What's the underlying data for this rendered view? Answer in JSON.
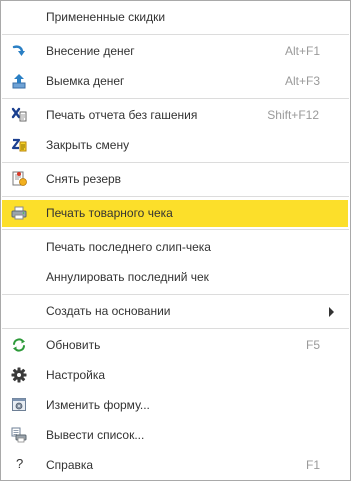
{
  "menu": {
    "items": [
      {
        "label": "Примененные скидки",
        "shortcut": ""
      },
      {
        "label": "Внесение денег",
        "shortcut": "Alt+F1",
        "icon": "deposit-arrow-icon"
      },
      {
        "label": "Выемка денег",
        "shortcut": "Alt+F3",
        "icon": "withdraw-upload-icon"
      },
      {
        "label": "Печать отчета без гашения",
        "shortcut": "Shift+F12",
        "icon": "x-report-icon"
      },
      {
        "label": "Закрыть смену",
        "shortcut": "",
        "icon": "z-report-icon"
      },
      {
        "label": "Снять резерв",
        "shortcut": "",
        "icon": "release-reserve-icon"
      },
      {
        "label": "Печать товарного чека",
        "shortcut": "",
        "icon": "printer-icon",
        "highlighted": true
      },
      {
        "label": "Печать последнего слип-чека",
        "shortcut": ""
      },
      {
        "label": "Аннулировать последний чек",
        "shortcut": ""
      },
      {
        "label": "Создать на основании",
        "shortcut": "",
        "submenu": true
      },
      {
        "label": "Обновить",
        "shortcut": "F5",
        "icon": "refresh-icon"
      },
      {
        "label": "Настройка",
        "shortcut": "",
        "icon": "gear-icon"
      },
      {
        "label": "Изменить форму...",
        "shortcut": "",
        "icon": "form-edit-icon"
      },
      {
        "label": "Вывести список...",
        "shortcut": "",
        "icon": "output-list-icon"
      },
      {
        "label": "Справка",
        "shortcut": "F1",
        "icon": "help-icon",
        "icon_glyph": "?"
      }
    ]
  },
  "colors": {
    "highlight": "#fcdf2a",
    "border": "#a9a9a9",
    "separator": "#dcdcdc",
    "text": "#333333",
    "shortcut_text": "#9a9a9a"
  }
}
